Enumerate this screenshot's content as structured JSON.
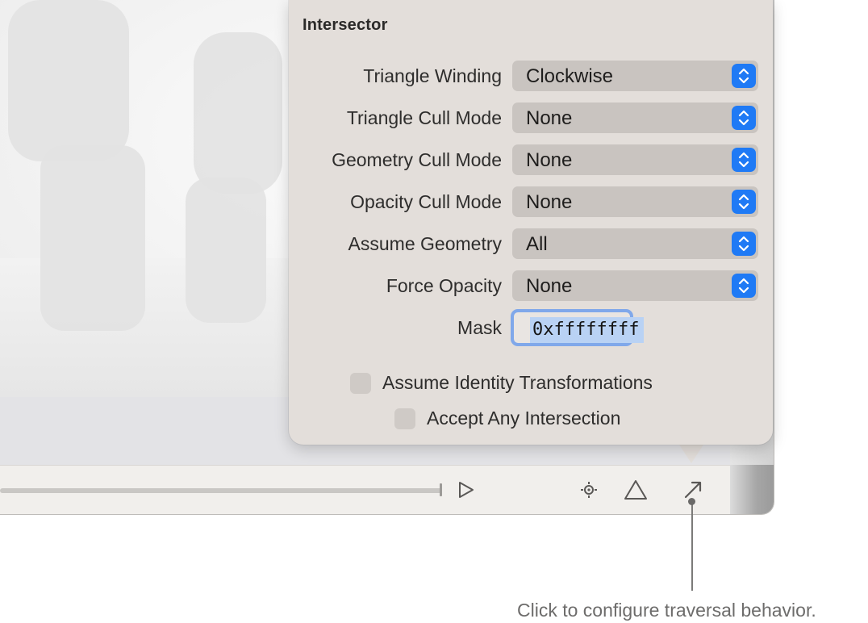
{
  "popover": {
    "title": "Intersector",
    "rows": [
      {
        "label": "Triangle Winding",
        "value": "Clockwise"
      },
      {
        "label": "Triangle Cull Mode",
        "value": "None"
      },
      {
        "label": "Geometry Cull Mode",
        "value": "None"
      },
      {
        "label": "Opacity Cull Mode",
        "value": "None"
      },
      {
        "label": "Assume Geometry",
        "value": "All"
      },
      {
        "label": "Force Opacity",
        "value": "None"
      }
    ],
    "mask": {
      "label": "Mask",
      "value": "0xffffffff"
    },
    "checkboxes": [
      {
        "label": "Assume Identity Transformations",
        "checked": false
      },
      {
        "label": "Accept Any Intersection",
        "checked": false
      }
    ]
  },
  "toolbar": {
    "icons": [
      "play-icon",
      "camera-target-icon",
      "triangle-icon",
      "arrow-diagonal-icon"
    ]
  },
  "callout": {
    "text": "Click to configure traversal behavior."
  },
  "colors": {
    "accent": "#1f7af5",
    "focus_ring": "#80a8ea",
    "selection": "#b9d2f4",
    "popover_bg": "#e3deda"
  }
}
